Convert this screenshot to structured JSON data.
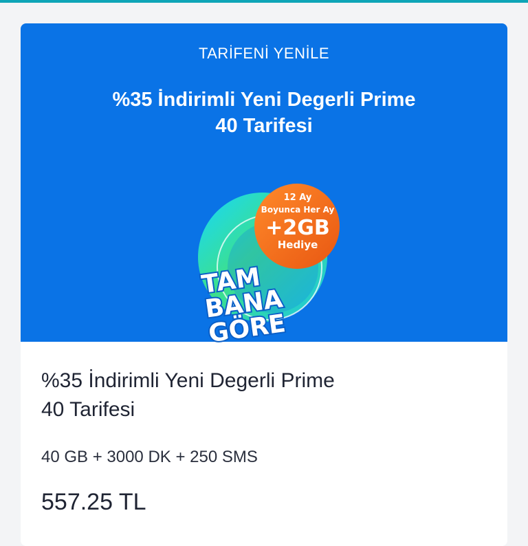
{
  "hero": {
    "eyebrow": "TARİFENİ YENİLE",
    "title_line1": "%35 İndirimli Yeni Degerli Prime",
    "title_line2": "40 Tarifesi",
    "badge": {
      "line1": "12 Ay",
      "line2": "Boyunca Her Ay",
      "amount": "+2GB",
      "gift": "Hediye",
      "brand1": "TAM",
      "brand2": "BANA",
      "brand3": "GÖRE"
    }
  },
  "plan": {
    "title_line1": "%35 İndirimli Yeni Degerli Prime",
    "title_line2": "40 Tarifesi",
    "features": "40 GB + 3000 DK + 250 SMS",
    "price": "557.25 TL"
  },
  "colors": {
    "topbar": "#0ea5b7",
    "hero_bg": "#0a73e6",
    "orange": "#f06a1f"
  }
}
